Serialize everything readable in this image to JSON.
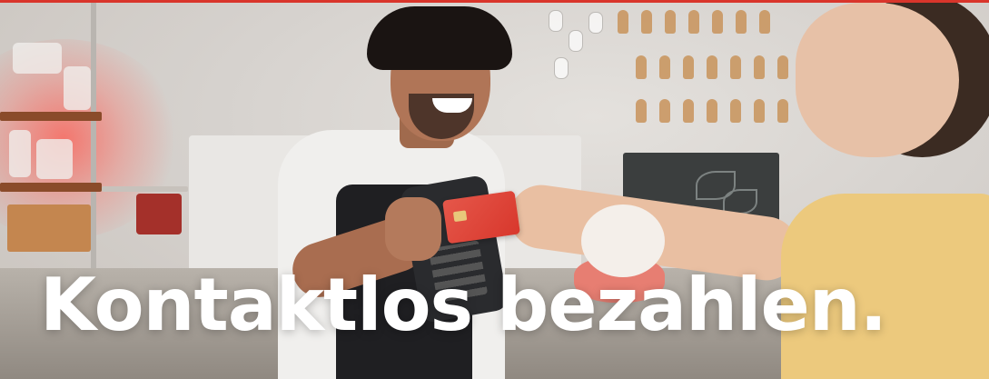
{
  "banner": {
    "headline": "Kontaktlos bezahlen.",
    "accent_color": "#d9352b",
    "headline_color": "#ffffff",
    "photo_subject": "ice-cream shop vendor holding card terminal while customer pays contactless with red card"
  }
}
